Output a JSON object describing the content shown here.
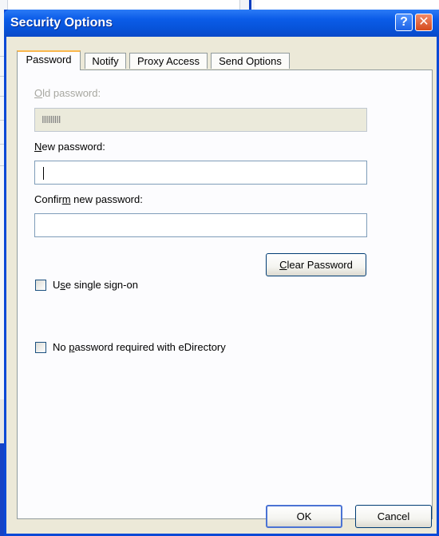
{
  "dialog": {
    "title": "Security Options",
    "help_glyph": "?",
    "close_glyph": "✕"
  },
  "tabs": [
    {
      "label": "Password",
      "active": true
    },
    {
      "label": "Notify",
      "active": false
    },
    {
      "label": "Proxy Access",
      "active": false
    },
    {
      "label": "Send Options",
      "active": false
    }
  ],
  "password_tab": {
    "old_password": {
      "label_u": "O",
      "label_rest": "ld password:",
      "value": "IIIIIIIII",
      "enabled": false
    },
    "new_password": {
      "label_u": "N",
      "label_rest": "ew password:",
      "value": ""
    },
    "confirm_password": {
      "label_pre": "Confir",
      "label_u": "m",
      "label_rest": " new password:",
      "value": ""
    },
    "clear_button": {
      "label_u": "C",
      "label_rest": "lear Password"
    },
    "single_sign_on": {
      "label_pre": "U",
      "label_u": "s",
      "label_rest": "e single sign-on",
      "checked": false
    },
    "no_password_edir": {
      "label_pre": "No ",
      "label_u": "p",
      "label_rest": "assword required with eDirectory",
      "checked": false
    }
  },
  "footer": {
    "ok_label": "OK",
    "cancel_label": "Cancel"
  },
  "colors": {
    "titlebar": "#0753d9",
    "dialog_face": "#ece9d8",
    "active_tab_accent": "#f9b74d"
  }
}
